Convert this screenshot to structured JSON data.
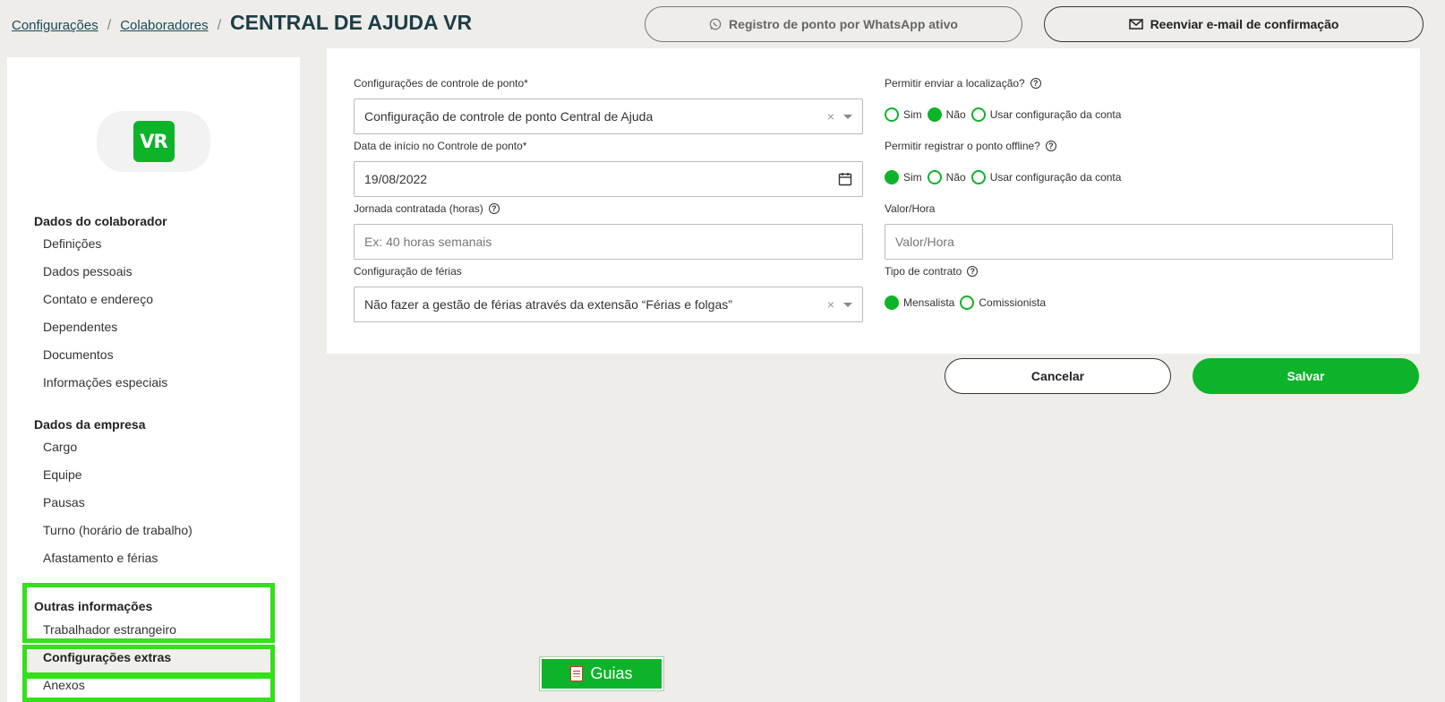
{
  "breadcrumb": {
    "link1": "Configurações",
    "link2": "Colaboradores",
    "separator": "/",
    "current": "CENTRAL DE AJUDA VR"
  },
  "header": {
    "whatsapp_label": "Registro de ponto por WhatsApp ativo",
    "resend_label": "Reenviar e-mail de confirmação"
  },
  "logo": {
    "text": "VR"
  },
  "sidebar": {
    "sections": [
      {
        "title": "Dados do colaborador",
        "items": [
          "Definições",
          "Dados pessoais",
          "Contato e endereço",
          "Dependentes",
          "Documentos",
          "Informações especiais"
        ]
      },
      {
        "title": "Dados da empresa",
        "items": [
          "Cargo",
          "Equipe",
          "Pausas",
          "Turno (horário de trabalho)",
          "Afastamento e férias"
        ]
      },
      {
        "title": "Outras informações",
        "items": [
          "Trabalhador estrangeiro",
          "Configurações extras",
          "Anexos"
        ]
      }
    ],
    "active_item": "Configurações extras"
  },
  "form": {
    "control_config": {
      "label": "Configurações de controle de ponto*",
      "value": "Configuração de controle de ponto Central de Ajuda"
    },
    "start_date": {
      "label": "Data de início no Controle de ponto*",
      "value": "19/08/2022"
    },
    "journey": {
      "label": "Jornada contratada (horas)",
      "placeholder": "Ex: 40 horas semanais"
    },
    "vacation": {
      "label": "Configuração de férias",
      "value": "Não fazer a gestão de férias através da extensão “Férias e folgas”"
    },
    "location": {
      "label": "Permitir enviar a localização?",
      "options": [
        "Sim",
        "Não",
        "Usar configuração da conta"
      ],
      "selected": "Não"
    },
    "offline": {
      "label": "Permitir registrar o ponto offline?",
      "options": [
        "Sim",
        "Não",
        "Usar configuração da conta"
      ],
      "selected": "Sim"
    },
    "hour_value": {
      "label": "Valor/Hora",
      "placeholder": "Valor/Hora"
    },
    "contract": {
      "label": "Tipo de contrato",
      "options": [
        "Mensalista",
        "Comissionista"
      ],
      "selected": "Mensalista"
    },
    "clear_symbol": "×",
    "help_symbol": "?"
  },
  "actions": {
    "cancel": "Cancelar",
    "save": "Salvar"
  },
  "guias": {
    "label": "Guias"
  },
  "colors": {
    "accent": "#0db429",
    "highlight": "#33e01a",
    "background": "#eeede9",
    "title": "#1d3c47"
  }
}
